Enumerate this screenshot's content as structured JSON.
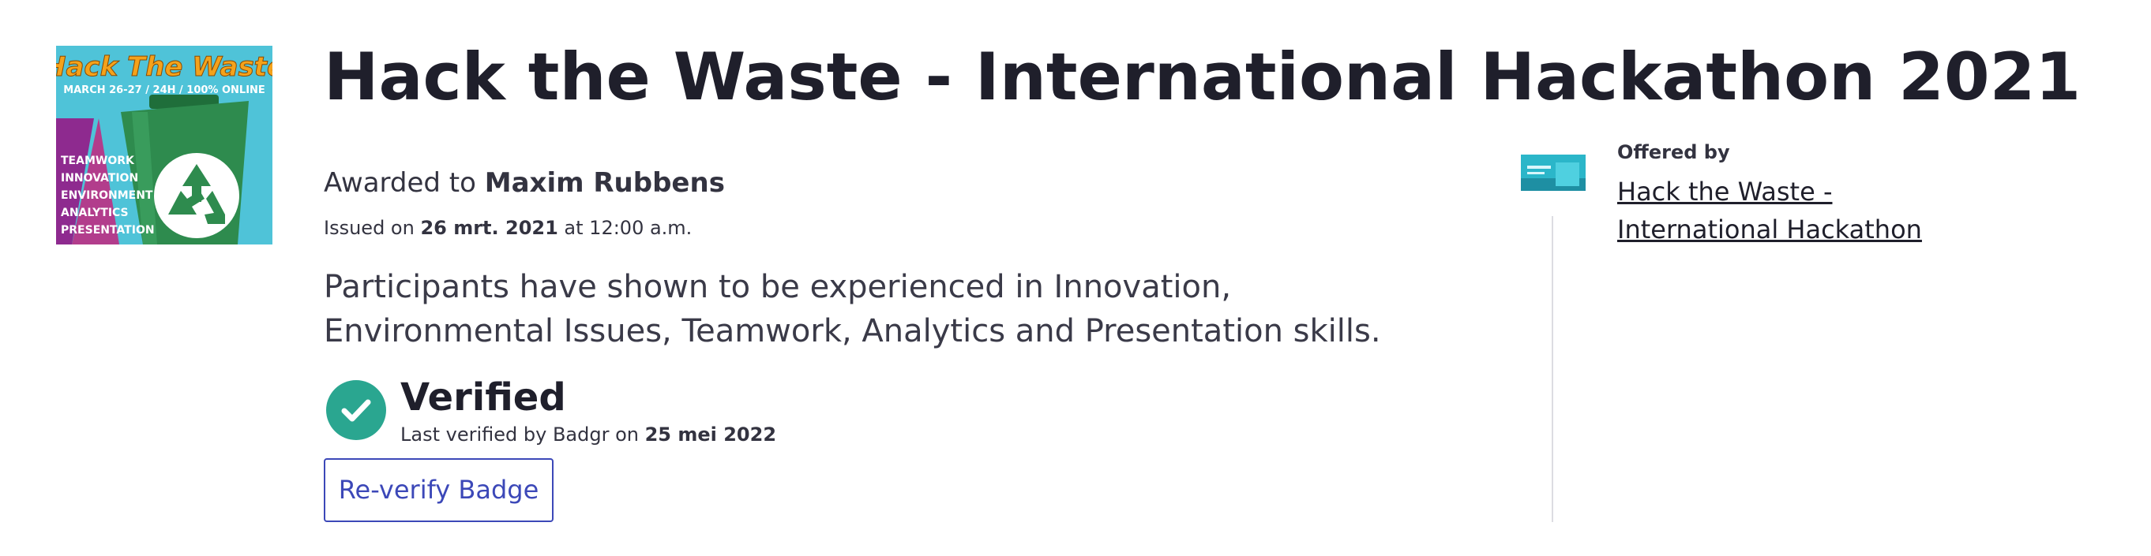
{
  "badge": {
    "image_title": "Hack The Waste",
    "image_subtitle": "MARCH 26-27 / 24H / 100% ONLINE",
    "image_skills": [
      "TEAMWORK",
      "INNOVATION",
      "ENVIRONMENT",
      "ANALYTICS",
      "PRESENTATION"
    ],
    "title": "Hack the Waste - International Hackathon 2021",
    "awarded_prefix": "Awarded to ",
    "recipient": "Maxim Rubbens",
    "issued_prefix": "Issued on ",
    "issued_date": "26 mrt. 2021",
    "issued_time_suffix": " at 12:00 a.m.",
    "description": "Participants have shown to be experienced in Innovation, Environmental Issues, Teamwork, Analytics and Presentation skills."
  },
  "verification": {
    "status": "Verified",
    "last_verified_prefix": "Last verified by Badgr on ",
    "last_verified_date": "25 mei 2022",
    "reverify_label": "Re-verify Badge"
  },
  "issuer": {
    "offered_by_label": "Offered by",
    "name": "Hack the Waste - International Hackathon"
  },
  "colors": {
    "verified_green": "#2aa690",
    "link_blue": "#3c48b8",
    "badge_orange": "#f4a21b"
  }
}
